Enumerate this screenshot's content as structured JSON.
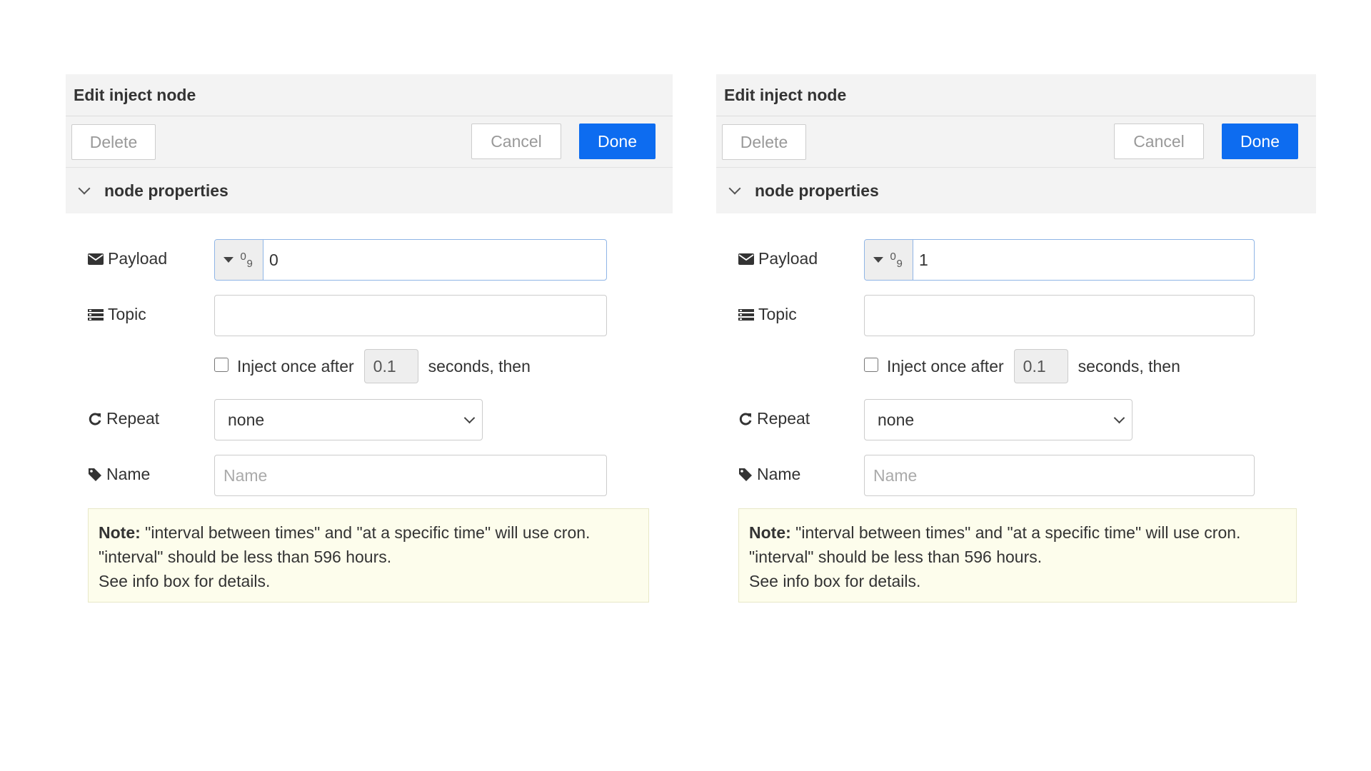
{
  "panels": [
    {
      "title": "Edit inject node",
      "buttons": {
        "delete": "Delete",
        "cancel": "Cancel",
        "done": "Done"
      },
      "section": "node properties",
      "payload": {
        "label": "Payload",
        "type_icon_top": "0",
        "type_icon_bottom": "9",
        "value": "0"
      },
      "topic": {
        "label": "Topic",
        "value": ""
      },
      "inject": {
        "label": "Inject once after",
        "value": "0.1",
        "suffix": "seconds, then",
        "checked": false
      },
      "repeat": {
        "label": "Repeat",
        "selected": "none"
      },
      "name": {
        "label": "Name",
        "placeholder": "Name"
      },
      "note": {
        "bold": "Note:",
        "line1": " \"interval between times\" and \"at a specific time\" will use cron.",
        "line2": "\"interval\" should be less than 596 hours.",
        "line3": "See info box for details."
      }
    },
    {
      "title": "Edit inject node",
      "buttons": {
        "delete": "Delete",
        "cancel": "Cancel",
        "done": "Done"
      },
      "section": "node properties",
      "payload": {
        "label": "Payload",
        "type_icon_top": "0",
        "type_icon_bottom": "9",
        "value": "1"
      },
      "topic": {
        "label": "Topic",
        "value": ""
      },
      "inject": {
        "label": "Inject once after",
        "value": "0.1",
        "suffix": "seconds, then",
        "checked": false
      },
      "repeat": {
        "label": "Repeat",
        "selected": "none"
      },
      "name": {
        "label": "Name",
        "placeholder": "Name"
      },
      "note": {
        "bold": "Note:",
        "line1": " \"interval between times\" and \"at a specific time\" will use cron.",
        "line2": "\"interval\" should be less than 596 hours.",
        "line3": "See info box for details."
      }
    }
  ],
  "colors": {
    "primary": "#0d6cf0",
    "header_bg": "#f3f3f3",
    "note_bg": "#fdfdec"
  },
  "icons": {
    "payload": "envelope-icon",
    "topic": "list-icon",
    "repeat": "refresh-icon",
    "name": "tag-icon"
  }
}
